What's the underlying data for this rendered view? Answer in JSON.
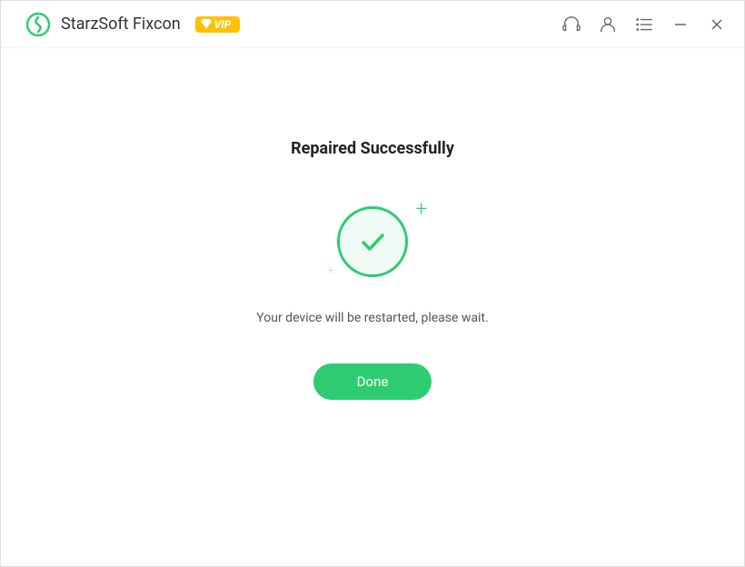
{
  "titlebar": {
    "app_name": "StarzSoft Fixcon",
    "vip_label": "VIP"
  },
  "content": {
    "heading": "Repaired Successfully",
    "subtext": "Your device will be restarted, please wait.",
    "done_button_label": "Done"
  },
  "colors": {
    "accent": "#2ecc71",
    "vip_badge": "#ffc107"
  }
}
